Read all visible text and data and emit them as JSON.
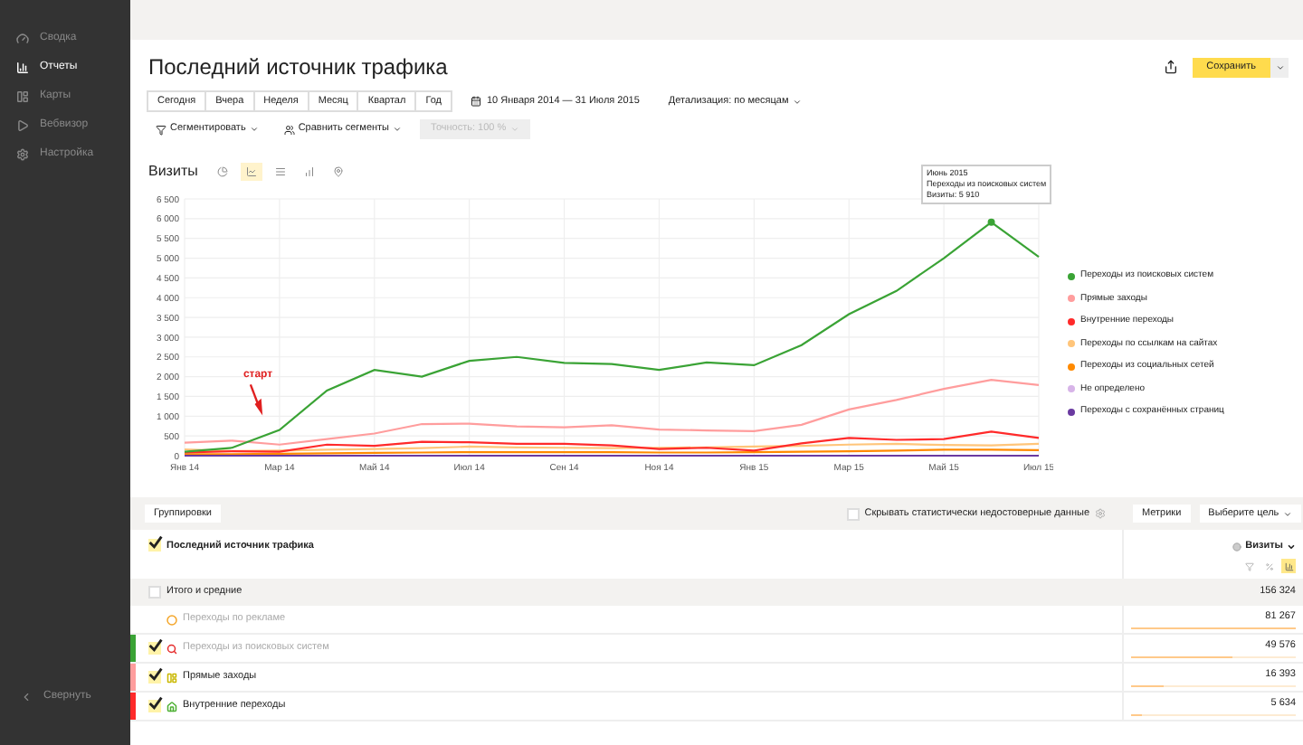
{
  "sidebar": {
    "items": [
      {
        "label": "Сводка",
        "selected": false
      },
      {
        "label": "Отчеты",
        "selected": true
      },
      {
        "label": "Карты",
        "selected": false
      },
      {
        "label": "Вебвизор",
        "selected": false
      },
      {
        "label": "Настройка",
        "selected": false
      }
    ],
    "collapse": "Свернуть"
  },
  "title": "Последний источник трафика",
  "save_button": "Сохранить",
  "periods": [
    {
      "label": "Сегодня",
      "selected": false
    },
    {
      "label": "Вчера",
      "selected": false
    },
    {
      "label": "Неделя",
      "selected": false
    },
    {
      "label": "Месяц",
      "selected": false
    },
    {
      "label": "Квартал",
      "selected": false
    },
    {
      "label": "Год",
      "selected": false
    }
  ],
  "date_range": "10 Января 2014 — 31 Июля 2015",
  "detail": "Детализация: по месяцам",
  "segment": "Сегментировать",
  "compare": "Сравнить сегменты",
  "accuracy": {
    "label": "Точность: 100 %",
    "disabled": true
  },
  "chart_title": "Визиты",
  "chart_types": [
    {
      "kind": "pie",
      "selected": false
    },
    {
      "kind": "line",
      "selected": true
    },
    {
      "kind": "stacked",
      "selected": false
    },
    {
      "kind": "bars",
      "selected": false
    },
    {
      "kind": "map",
      "selected": false
    }
  ],
  "tooltip": [
    "Июнь 2015",
    "Переходы из поисковых систем",
    "Визиты: 5 910"
  ],
  "annotation": "старт",
  "chart_data": {
    "type": "line",
    "categories": [
      "Янв 14",
      null,
      "Мар 14",
      null,
      "Май 14",
      null,
      "Июл 14",
      null,
      "Сен 14",
      null,
      "Ноя 14",
      null,
      "Янв 15",
      null,
      "Мар 15",
      null,
      "Май 15",
      null,
      "Июл 15"
    ],
    "grid": true,
    "yticks": [
      {
        "value": 0,
        "label": "0"
      },
      {
        "value": 500,
        "label": "500"
      },
      {
        "value": 1000,
        "label": "1 000"
      },
      {
        "value": 1500,
        "label": "1 500"
      },
      {
        "value": 2000,
        "label": "2 000"
      },
      {
        "value": 2500,
        "label": "2 500"
      },
      {
        "value": 3000,
        "label": "3 000"
      },
      {
        "value": 3500,
        "label": "3 500"
      },
      {
        "value": 4000,
        "label": "4 000"
      },
      {
        "value": 4500,
        "label": "4 500"
      },
      {
        "value": 5000,
        "label": "5 000"
      },
      {
        "value": 5500,
        "label": "5 500"
      },
      {
        "value": 6000,
        "label": "6 000"
      },
      {
        "value": 6500,
        "label": "6 500"
      }
    ],
    "ylim": [
      0,
      6500
    ],
    "series": [
      {
        "name": "Переходы из поисковых систем",
        "color": "#3aa335",
        "values": [
          100,
          200,
          650,
          1650,
          2170,
          2000,
          2400,
          2500,
          2350,
          2320,
          2170,
          2360,
          2290,
          2800,
          3580,
          4170,
          5000,
          5910,
          5030
        ]
      },
      {
        "name": "Прямые заходы",
        "color": "#ff9d9d",
        "values": [
          330,
          380,
          280,
          420,
          560,
          800,
          810,
          740,
          720,
          770,
          660,
          640,
          620,
          780,
          1170,
          1410,
          1690,
          1920,
          1790
        ]
      },
      {
        "name": "Внутренние переходы",
        "color": "#ff2a2a",
        "values": [
          80,
          110,
          100,
          280,
          250,
          350,
          340,
          300,
          300,
          260,
          170,
          200,
          130,
          310,
          450,
          400,
          420,
          610,
          450
        ]
      },
      {
        "name": "Переходы по ссылкам на сайтах",
        "color": "#ffc57a",
        "values": [
          160,
          120,
          130,
          150,
          170,
          190,
          230,
          210,
          200,
          190,
          200,
          210,
          230,
          250,
          280,
          300,
          270,
          260,
          300
        ]
      },
      {
        "name": "Переходы из социальных сетей",
        "color": "#ff8a00",
        "values": [
          40,
          40,
          50,
          60,
          70,
          80,
          90,
          90,
          90,
          90,
          80,
          80,
          90,
          100,
          110,
          130,
          150,
          150,
          140
        ]
      },
      {
        "name": "Не определено",
        "color": "#d7b4e8",
        "values": [
          null,
          null,
          null,
          null,
          null,
          null,
          null,
          null,
          null,
          null,
          null,
          null,
          null,
          null,
          null,
          null,
          null,
          null,
          null
        ]
      },
      {
        "name": "Переходы с сохранённых страниц",
        "color": "#6a3aa0",
        "values": [
          0,
          0,
          0,
          0,
          0,
          0,
          0,
          0,
          0,
          0,
          0,
          0,
          0,
          0,
          0,
          0,
          0,
          0,
          0
        ]
      }
    ]
  },
  "table": {
    "groupings": "Группировки",
    "hide_unreliable": {
      "label": "Скрывать статистически недостоверные данные",
      "checked": false
    },
    "metrics": "Метрики",
    "goal": "Выберите цель",
    "dimension": {
      "label": "Последний источник трафика",
      "checked": true
    },
    "metric": "Визиты",
    "metric_views": [
      {
        "kind": "filter",
        "selected": false
      },
      {
        "kind": "percent",
        "selected": false
      },
      {
        "kind": "bars",
        "selected": true
      }
    ],
    "total": {
      "label": "Итого и средние",
      "checked": false,
      "value": "156 324"
    },
    "rows": [
      {
        "label": "Переходы по рекламе",
        "checked": false,
        "dimmed": true,
        "value": "81 267",
        "level": 1
      },
      {
        "label": "Переходы из поисковых систем",
        "checked": true,
        "dimmed": true,
        "value": "49 576",
        "level": 0.61,
        "color": "#3aa335"
      },
      {
        "label": "Прямые заходы",
        "checked": true,
        "dimmed": false,
        "value": "16 393",
        "level": 0.2,
        "color": "#ff9d9d"
      },
      {
        "label": "Внутренние переходы",
        "checked": true,
        "dimmed": false,
        "value": "5 634",
        "level": 0.07,
        "color": "#ff2a2a"
      }
    ]
  }
}
